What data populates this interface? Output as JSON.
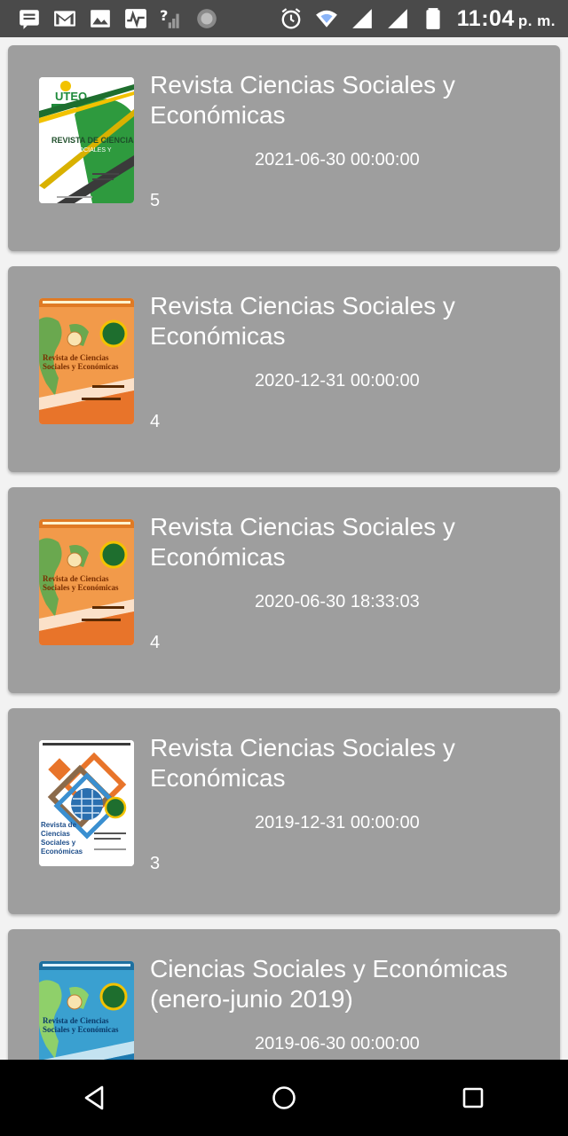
{
  "status_bar": {
    "time": "11:04",
    "ampm": "p. m.",
    "left_icons": [
      "message-icon",
      "gmail-icon",
      "image-icon",
      "activity-icon",
      "no-signal-icon",
      "circle-app-icon"
    ],
    "right_icons": [
      "alarm-icon",
      "wifi-icon",
      "signal-icon",
      "signal-icon",
      "battery-icon"
    ]
  },
  "issues": [
    {
      "title": "Revista Ciencias Sociales y Económicas",
      "date": "2021-06-30 00:00:00",
      "number": "5",
      "cover": "uteq-green"
    },
    {
      "title": "Revista Ciencias Sociales y Económicas",
      "date": "2020-12-31 00:00:00",
      "number": "4",
      "cover": "orange-map"
    },
    {
      "title": "Revista Ciencias Sociales y Económicas",
      "date": "2020-06-30 18:33:03",
      "number": "4",
      "cover": "orange-map"
    },
    {
      "title": "Revista Ciencias Sociales y Económicas",
      "date": "2019-12-31 00:00:00",
      "number": "3",
      "cover": "globe-diamond"
    },
    {
      "title": "Ciencias Sociales y Económicas (enero-junio 2019)",
      "date": "2019-06-30 00:00:00",
      "number": "",
      "cover": "blue-map"
    }
  ],
  "nav_bar": {
    "buttons": [
      "back-icon",
      "home-icon",
      "recents-icon"
    ]
  },
  "colors": {
    "card": "#9e9e9e",
    "status_bar": "#4a4a4a",
    "nav_bar": "#000000",
    "background": "#f2f2f2"
  }
}
